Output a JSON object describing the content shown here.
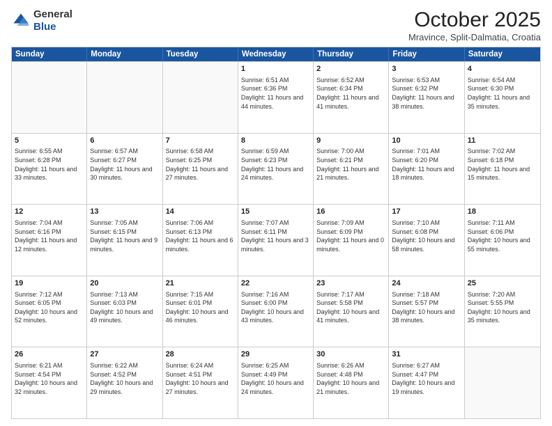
{
  "header": {
    "logo_general": "General",
    "logo_blue": "Blue",
    "month_title": "October 2025",
    "location": "Mravince, Split-Dalmatia, Croatia"
  },
  "weekdays": [
    "Sunday",
    "Monday",
    "Tuesday",
    "Wednesday",
    "Thursday",
    "Friday",
    "Saturday"
  ],
  "rows": [
    [
      {
        "day": "",
        "info": ""
      },
      {
        "day": "",
        "info": ""
      },
      {
        "day": "",
        "info": ""
      },
      {
        "day": "1",
        "info": "Sunrise: 6:51 AM\nSunset: 6:36 PM\nDaylight: 11 hours and 44 minutes."
      },
      {
        "day": "2",
        "info": "Sunrise: 6:52 AM\nSunset: 6:34 PM\nDaylight: 11 hours and 41 minutes."
      },
      {
        "day": "3",
        "info": "Sunrise: 6:53 AM\nSunset: 6:32 PM\nDaylight: 11 hours and 38 minutes."
      },
      {
        "day": "4",
        "info": "Sunrise: 6:54 AM\nSunset: 6:30 PM\nDaylight: 11 hours and 35 minutes."
      }
    ],
    [
      {
        "day": "5",
        "info": "Sunrise: 6:55 AM\nSunset: 6:28 PM\nDaylight: 11 hours and 33 minutes."
      },
      {
        "day": "6",
        "info": "Sunrise: 6:57 AM\nSunset: 6:27 PM\nDaylight: 11 hours and 30 minutes."
      },
      {
        "day": "7",
        "info": "Sunrise: 6:58 AM\nSunset: 6:25 PM\nDaylight: 11 hours and 27 minutes."
      },
      {
        "day": "8",
        "info": "Sunrise: 6:59 AM\nSunset: 6:23 PM\nDaylight: 11 hours and 24 minutes."
      },
      {
        "day": "9",
        "info": "Sunrise: 7:00 AM\nSunset: 6:21 PM\nDaylight: 11 hours and 21 minutes."
      },
      {
        "day": "10",
        "info": "Sunrise: 7:01 AM\nSunset: 6:20 PM\nDaylight: 11 hours and 18 minutes."
      },
      {
        "day": "11",
        "info": "Sunrise: 7:02 AM\nSunset: 6:18 PM\nDaylight: 11 hours and 15 minutes."
      }
    ],
    [
      {
        "day": "12",
        "info": "Sunrise: 7:04 AM\nSunset: 6:16 PM\nDaylight: 11 hours and 12 minutes."
      },
      {
        "day": "13",
        "info": "Sunrise: 7:05 AM\nSunset: 6:15 PM\nDaylight: 11 hours and 9 minutes."
      },
      {
        "day": "14",
        "info": "Sunrise: 7:06 AM\nSunset: 6:13 PM\nDaylight: 11 hours and 6 minutes."
      },
      {
        "day": "15",
        "info": "Sunrise: 7:07 AM\nSunset: 6:11 PM\nDaylight: 11 hours and 3 minutes."
      },
      {
        "day": "16",
        "info": "Sunrise: 7:09 AM\nSunset: 6:09 PM\nDaylight: 11 hours and 0 minutes."
      },
      {
        "day": "17",
        "info": "Sunrise: 7:10 AM\nSunset: 6:08 PM\nDaylight: 10 hours and 58 minutes."
      },
      {
        "day": "18",
        "info": "Sunrise: 7:11 AM\nSunset: 6:06 PM\nDaylight: 10 hours and 55 minutes."
      }
    ],
    [
      {
        "day": "19",
        "info": "Sunrise: 7:12 AM\nSunset: 6:05 PM\nDaylight: 10 hours and 52 minutes."
      },
      {
        "day": "20",
        "info": "Sunrise: 7:13 AM\nSunset: 6:03 PM\nDaylight: 10 hours and 49 minutes."
      },
      {
        "day": "21",
        "info": "Sunrise: 7:15 AM\nSunset: 6:01 PM\nDaylight: 10 hours and 46 minutes."
      },
      {
        "day": "22",
        "info": "Sunrise: 7:16 AM\nSunset: 6:00 PM\nDaylight: 10 hours and 43 minutes."
      },
      {
        "day": "23",
        "info": "Sunrise: 7:17 AM\nSunset: 5:58 PM\nDaylight: 10 hours and 41 minutes."
      },
      {
        "day": "24",
        "info": "Sunrise: 7:18 AM\nSunset: 5:57 PM\nDaylight: 10 hours and 38 minutes."
      },
      {
        "day": "25",
        "info": "Sunrise: 7:20 AM\nSunset: 5:55 PM\nDaylight: 10 hours and 35 minutes."
      }
    ],
    [
      {
        "day": "26",
        "info": "Sunrise: 6:21 AM\nSunset: 4:54 PM\nDaylight: 10 hours and 32 minutes."
      },
      {
        "day": "27",
        "info": "Sunrise: 6:22 AM\nSunset: 4:52 PM\nDaylight: 10 hours and 29 minutes."
      },
      {
        "day": "28",
        "info": "Sunrise: 6:24 AM\nSunset: 4:51 PM\nDaylight: 10 hours and 27 minutes."
      },
      {
        "day": "29",
        "info": "Sunrise: 6:25 AM\nSunset: 4:49 PM\nDaylight: 10 hours and 24 minutes."
      },
      {
        "day": "30",
        "info": "Sunrise: 6:26 AM\nSunset: 4:48 PM\nDaylight: 10 hours and 21 minutes."
      },
      {
        "day": "31",
        "info": "Sunrise: 6:27 AM\nSunset: 4:47 PM\nDaylight: 10 hours and 19 minutes."
      },
      {
        "day": "",
        "info": ""
      }
    ]
  ]
}
